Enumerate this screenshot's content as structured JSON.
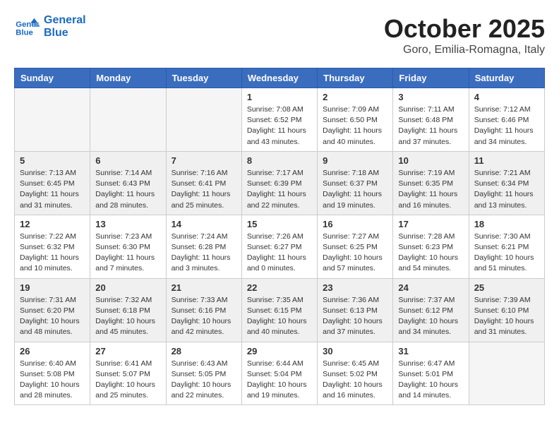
{
  "header": {
    "logo_line1": "General",
    "logo_line2": "Blue",
    "month": "October 2025",
    "location": "Goro, Emilia-Romagna, Italy"
  },
  "weekdays": [
    "Sunday",
    "Monday",
    "Tuesday",
    "Wednesday",
    "Thursday",
    "Friday",
    "Saturday"
  ],
  "weeks": [
    {
      "shaded": false,
      "days": [
        {
          "num": "",
          "info": ""
        },
        {
          "num": "",
          "info": ""
        },
        {
          "num": "",
          "info": ""
        },
        {
          "num": "1",
          "info": "Sunrise: 7:08 AM\nSunset: 6:52 PM\nDaylight: 11 hours\nand 43 minutes."
        },
        {
          "num": "2",
          "info": "Sunrise: 7:09 AM\nSunset: 6:50 PM\nDaylight: 11 hours\nand 40 minutes."
        },
        {
          "num": "3",
          "info": "Sunrise: 7:11 AM\nSunset: 6:48 PM\nDaylight: 11 hours\nand 37 minutes."
        },
        {
          "num": "4",
          "info": "Sunrise: 7:12 AM\nSunset: 6:46 PM\nDaylight: 11 hours\nand 34 minutes."
        }
      ]
    },
    {
      "shaded": true,
      "days": [
        {
          "num": "5",
          "info": "Sunrise: 7:13 AM\nSunset: 6:45 PM\nDaylight: 11 hours\nand 31 minutes."
        },
        {
          "num": "6",
          "info": "Sunrise: 7:14 AM\nSunset: 6:43 PM\nDaylight: 11 hours\nand 28 minutes."
        },
        {
          "num": "7",
          "info": "Sunrise: 7:16 AM\nSunset: 6:41 PM\nDaylight: 11 hours\nand 25 minutes."
        },
        {
          "num": "8",
          "info": "Sunrise: 7:17 AM\nSunset: 6:39 PM\nDaylight: 11 hours\nand 22 minutes."
        },
        {
          "num": "9",
          "info": "Sunrise: 7:18 AM\nSunset: 6:37 PM\nDaylight: 11 hours\nand 19 minutes."
        },
        {
          "num": "10",
          "info": "Sunrise: 7:19 AM\nSunset: 6:35 PM\nDaylight: 11 hours\nand 16 minutes."
        },
        {
          "num": "11",
          "info": "Sunrise: 7:21 AM\nSunset: 6:34 PM\nDaylight: 11 hours\nand 13 minutes."
        }
      ]
    },
    {
      "shaded": false,
      "days": [
        {
          "num": "12",
          "info": "Sunrise: 7:22 AM\nSunset: 6:32 PM\nDaylight: 11 hours\nand 10 minutes."
        },
        {
          "num": "13",
          "info": "Sunrise: 7:23 AM\nSunset: 6:30 PM\nDaylight: 11 hours\nand 7 minutes."
        },
        {
          "num": "14",
          "info": "Sunrise: 7:24 AM\nSunset: 6:28 PM\nDaylight: 11 hours\nand 3 minutes."
        },
        {
          "num": "15",
          "info": "Sunrise: 7:26 AM\nSunset: 6:27 PM\nDaylight: 11 hours\nand 0 minutes."
        },
        {
          "num": "16",
          "info": "Sunrise: 7:27 AM\nSunset: 6:25 PM\nDaylight: 10 hours\nand 57 minutes."
        },
        {
          "num": "17",
          "info": "Sunrise: 7:28 AM\nSunset: 6:23 PM\nDaylight: 10 hours\nand 54 minutes."
        },
        {
          "num": "18",
          "info": "Sunrise: 7:30 AM\nSunset: 6:21 PM\nDaylight: 10 hours\nand 51 minutes."
        }
      ]
    },
    {
      "shaded": true,
      "days": [
        {
          "num": "19",
          "info": "Sunrise: 7:31 AM\nSunset: 6:20 PM\nDaylight: 10 hours\nand 48 minutes."
        },
        {
          "num": "20",
          "info": "Sunrise: 7:32 AM\nSunset: 6:18 PM\nDaylight: 10 hours\nand 45 minutes."
        },
        {
          "num": "21",
          "info": "Sunrise: 7:33 AM\nSunset: 6:16 PM\nDaylight: 10 hours\nand 42 minutes."
        },
        {
          "num": "22",
          "info": "Sunrise: 7:35 AM\nSunset: 6:15 PM\nDaylight: 10 hours\nand 40 minutes."
        },
        {
          "num": "23",
          "info": "Sunrise: 7:36 AM\nSunset: 6:13 PM\nDaylight: 10 hours\nand 37 minutes."
        },
        {
          "num": "24",
          "info": "Sunrise: 7:37 AM\nSunset: 6:12 PM\nDaylight: 10 hours\nand 34 minutes."
        },
        {
          "num": "25",
          "info": "Sunrise: 7:39 AM\nSunset: 6:10 PM\nDaylight: 10 hours\nand 31 minutes."
        }
      ]
    },
    {
      "shaded": false,
      "days": [
        {
          "num": "26",
          "info": "Sunrise: 6:40 AM\nSunset: 5:08 PM\nDaylight: 10 hours\nand 28 minutes."
        },
        {
          "num": "27",
          "info": "Sunrise: 6:41 AM\nSunset: 5:07 PM\nDaylight: 10 hours\nand 25 minutes."
        },
        {
          "num": "28",
          "info": "Sunrise: 6:43 AM\nSunset: 5:05 PM\nDaylight: 10 hours\nand 22 minutes."
        },
        {
          "num": "29",
          "info": "Sunrise: 6:44 AM\nSunset: 5:04 PM\nDaylight: 10 hours\nand 19 minutes."
        },
        {
          "num": "30",
          "info": "Sunrise: 6:45 AM\nSunset: 5:02 PM\nDaylight: 10 hours\nand 16 minutes."
        },
        {
          "num": "31",
          "info": "Sunrise: 6:47 AM\nSunset: 5:01 PM\nDaylight: 10 hours\nand 14 minutes."
        },
        {
          "num": "",
          "info": ""
        }
      ]
    }
  ]
}
